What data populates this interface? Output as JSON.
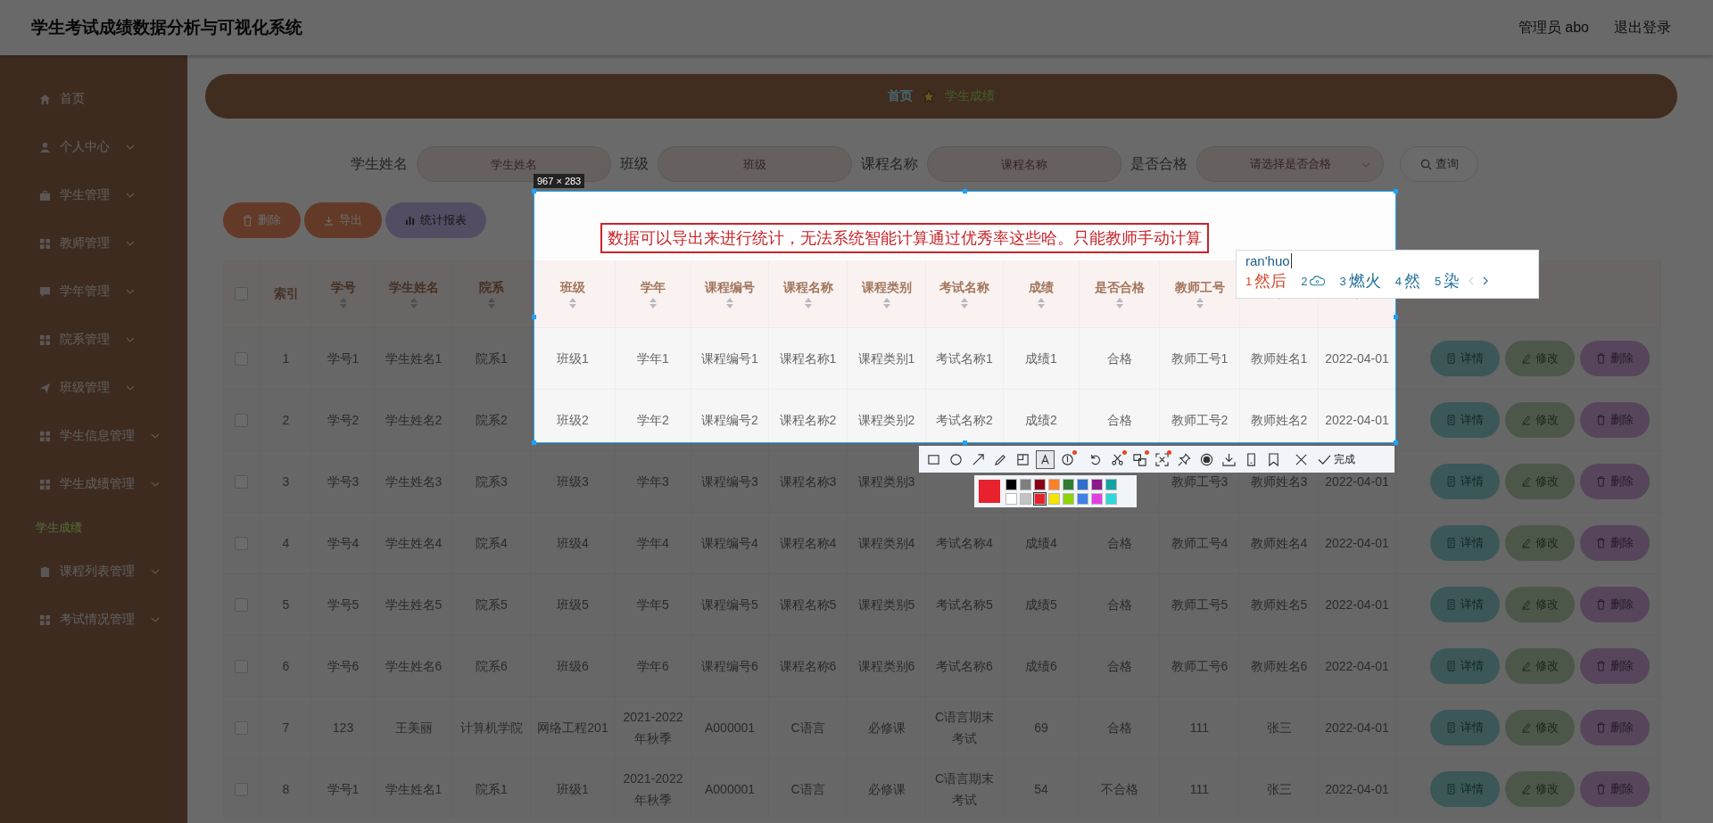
{
  "app": {
    "title": "学生考试成绩数据分析与可视化系统",
    "user": "管理员 abo",
    "logout": "退出登录"
  },
  "sidebar": {
    "items": [
      {
        "label": "首页",
        "kind": "link",
        "selected": false
      },
      {
        "label": "个人中心",
        "kind": "menu",
        "selected": false
      },
      {
        "label": "学生管理",
        "kind": "menu",
        "selected": false
      },
      {
        "label": "教师管理",
        "kind": "menu",
        "selected": false
      },
      {
        "label": "学年管理",
        "kind": "menu",
        "selected": false
      },
      {
        "label": "院系管理",
        "kind": "menu",
        "selected": false
      },
      {
        "label": "班级管理",
        "kind": "menu",
        "selected": false
      },
      {
        "label": "学生信息管理",
        "kind": "menu",
        "selected": false
      },
      {
        "label": "学生成绩管理",
        "kind": "menu",
        "selected": false
      },
      {
        "label": "学生成绩",
        "kind": "sub",
        "selected": true
      },
      {
        "label": "课程列表管理",
        "kind": "menu",
        "selected": false
      },
      {
        "label": "考试情况管理",
        "kind": "menu",
        "selected": false
      }
    ]
  },
  "breadcrumb": [
    {
      "label": "首页",
      "selected": false
    },
    {
      "label": "学生成绩",
      "selected": true
    }
  ],
  "filters": [
    {
      "label": "学生姓名",
      "placeholder": "学生姓名",
      "kind": "text"
    },
    {
      "label": "班级",
      "placeholder": "班级",
      "kind": "text"
    },
    {
      "label": "课程名称",
      "placeholder": "课程名称",
      "kind": "text"
    },
    {
      "label": "是否合格",
      "placeholder": "请选择是否合格",
      "kind": "select"
    }
  ],
  "search_button": "查询",
  "actions": [
    {
      "label": "删除",
      "kind": "delete"
    },
    {
      "label": "导出",
      "kind": "export"
    },
    {
      "label": "统计报表",
      "kind": "report"
    }
  ],
  "table": {
    "select_all": {
      "checked": false
    },
    "columns": [
      {
        "label": "索引",
        "sortable": false
      },
      {
        "label": "学号",
        "sortable": true
      },
      {
        "label": "学生姓名",
        "sortable": true
      },
      {
        "label": "院系",
        "sortable": true
      },
      {
        "label": "班级",
        "sortable": true
      },
      {
        "label": "学年",
        "sortable": true
      },
      {
        "label": "课程编号",
        "sortable": true
      },
      {
        "label": "课程名称",
        "sortable": true
      },
      {
        "label": "课程类别",
        "sortable": true
      },
      {
        "label": "考试名称",
        "sortable": true
      },
      {
        "label": "成绩",
        "sortable": true
      },
      {
        "label": "是否合格",
        "sortable": true
      },
      {
        "label": "教师工号",
        "sortable": true
      },
      {
        "sortable": true
      },
      {
        "sortable": true
      }
    ],
    "rows": [
      {
        "checked": false,
        "cells": [
          "1",
          "学号1",
          "学生姓名1",
          "院系1",
          "班级1",
          "学年1",
          "课程编号1",
          "课程名称1",
          "课程类别1",
          "考试名称1",
          "成绩1",
          "合格",
          "教师工号1",
          "教师姓名1",
          "2022-04-01"
        ],
        "actions": [
          "详情",
          "修改",
          "删除"
        ]
      },
      {
        "checked": false,
        "cells": [
          "2",
          "学号2",
          "学生姓名2",
          "院系2",
          "班级2",
          "学年2",
          "课程编号2",
          "课程名称2",
          "课程类别2",
          "考试名称2",
          "成绩2",
          "合格",
          "教师工号2",
          "教师姓名2",
          "2022-04-01"
        ],
        "actions": [
          "详情",
          "修改",
          "删除"
        ]
      },
      {
        "checked": false,
        "cells": [
          "3",
          "学号3",
          "学生姓名3",
          "院系3",
          "班级3",
          "学年3",
          "课程编号3",
          "课程名称3",
          "课程类别3",
          null,
          null,
          null,
          "教师工号3",
          "教师姓名3",
          "2022-04-01"
        ],
        "actions": [
          "详情",
          "修改",
          "删除"
        ]
      },
      {
        "checked": false,
        "cells": [
          "4",
          "学号4",
          "学生姓名4",
          "院系4",
          "班级4",
          "学年4",
          "课程编号4",
          "课程名称4",
          "课程类别4",
          "考试名称4",
          "成绩4",
          "合格",
          "教师工号4",
          "教师姓名4",
          "2022-04-01"
        ],
        "actions": [
          "详情",
          "修改",
          "删除"
        ]
      },
      {
        "checked": false,
        "cells": [
          "5",
          "学号5",
          "学生姓名5",
          "院系5",
          "班级5",
          "学年5",
          "课程编号5",
          "课程名称5",
          "课程类别5",
          "考试名称5",
          "成绩5",
          "合格",
          "教师工号5",
          "教师姓名5",
          "2022-04-01"
        ],
        "actions": [
          "详情",
          "修改",
          "删除"
        ]
      },
      {
        "checked": false,
        "cells": [
          "6",
          "学号6",
          "学生姓名6",
          "院系6",
          "班级6",
          "学年6",
          "课程编号6",
          "课程名称6",
          "课程类别6",
          "考试名称6",
          "成绩6",
          "合格",
          "教师工号6",
          "教师姓名6",
          "2022-04-01"
        ],
        "actions": [
          "详情",
          "修改",
          "删除"
        ]
      },
      {
        "checked": false,
        "cells": [
          "7",
          "123",
          "王美丽",
          "计算机学院",
          "网络工程201",
          "2021-2022年秋季",
          "A000001",
          "C语言",
          "必修课",
          "C语言期末考试",
          "69",
          "合格",
          "111",
          "张三",
          "2022-04-01"
        ],
        "actions": [
          "详情",
          "修改",
          "删除"
        ]
      },
      {
        "checked": false,
        "cells": [
          "8",
          "学号1",
          "学生姓名1",
          "院系1",
          "班级1",
          "2021-2022年秋季",
          "A000001",
          "C语言",
          "必修课",
          "C语言期末考试",
          "54",
          "不合格",
          "111",
          "张三",
          "2022-04-01"
        ],
        "actions": [
          "详情",
          "修改",
          "删除"
        ]
      }
    ]
  },
  "screenshot_tool": {
    "size_label": "967 × 283",
    "annotation": "数据可以导出来进行统计，无法系统智能计算通过优秀率这些哈。只能教师手动计算",
    "tools": [
      {
        "selected": false,
        "badge": false
      },
      {
        "selected": false,
        "badge": false
      },
      {
        "selected": false,
        "badge": false
      },
      {
        "selected": false,
        "badge": false
      },
      {
        "selected": false,
        "badge": false
      },
      {
        "selected": true,
        "badge": false
      },
      {
        "selected": false,
        "badge": true
      },
      {
        "selected": false,
        "badge": false
      },
      {
        "selected": false,
        "badge": true
      },
      {
        "selected": false,
        "badge": true
      },
      {
        "selected": false,
        "badge": true
      },
      {
        "selected": false,
        "badge": false
      },
      {
        "selected": false,
        "badge": false
      },
      {
        "selected": false,
        "badge": false
      },
      {
        "selected": false,
        "badge": false
      },
      {
        "selected": false,
        "badge": false
      },
      {
        "selected": false,
        "badge": false
      }
    ],
    "done_label": "完成",
    "swatches": [
      {
        "color": "#000000",
        "selected": false
      },
      {
        "color": "#7f7f7f",
        "selected": false
      },
      {
        "color": "#880015",
        "selected": false
      },
      {
        "color": "#ff7f27",
        "selected": false
      },
      {
        "color": "#2e7d32",
        "selected": false
      },
      {
        "color": "#2d6fcf",
        "selected": false
      },
      {
        "color": "#8b1a8b",
        "selected": false
      },
      {
        "color": "#13a3a3",
        "selected": false
      },
      {
        "color": "#ffffff",
        "selected": false
      },
      {
        "color": "#c3c3c3",
        "selected": false
      },
      {
        "color": "#e8212e",
        "selected": true
      },
      {
        "color": "#f5e400",
        "selected": false
      },
      {
        "color": "#8fd400",
        "selected": false
      },
      {
        "color": "#3f7fe8",
        "selected": false
      },
      {
        "color": "#e040e0",
        "selected": false
      },
      {
        "color": "#2fd8d8",
        "selected": false
      }
    ]
  },
  "ime": {
    "input": "ran'huo",
    "candidates": [
      {
        "number": "1",
        "text": "然后",
        "kind": "text",
        "selected": true
      },
      {
        "number": "2",
        "kind": "icon",
        "selected": false
      },
      {
        "number": "3",
        "text": "燃火",
        "kind": "text",
        "selected": false
      },
      {
        "number": "4",
        "text": "然",
        "kind": "text",
        "selected": false
      },
      {
        "number": "5",
        "text": "染",
        "kind": "text",
        "selected": false
      }
    ]
  }
}
